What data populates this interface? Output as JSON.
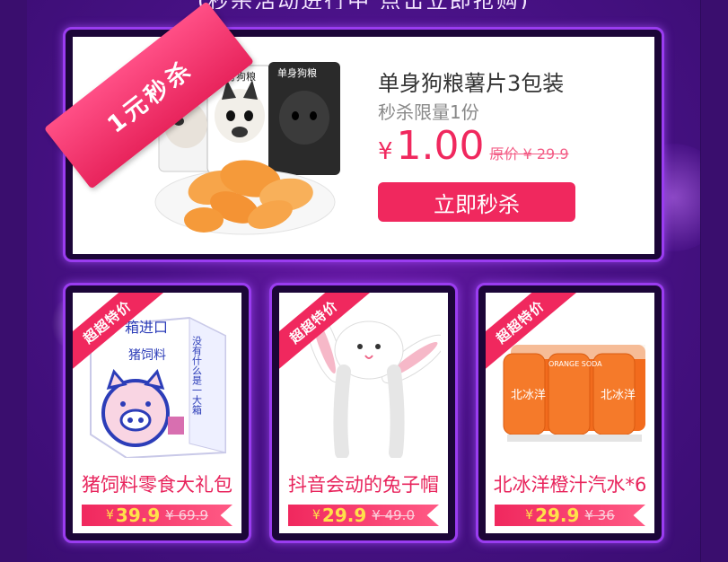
{
  "header_fragment": "(秒杀活动进行中 点击立即抢购)",
  "featured": {
    "ribbon": "1元秒杀",
    "title": "单身狗粮薯片3包装",
    "subtitle": "秒杀限量1份",
    "currency": "¥",
    "price": "1.00",
    "original_price": "原价 ¥ 29.9",
    "buy_label": "立即秒杀",
    "pack_label": "单身狗粮",
    "colors": {
      "accent": "#f0285e",
      "frame": "#9a3cf0"
    }
  },
  "products": [
    {
      "tag": "超超特价",
      "name": "猪饲料零食大礼包",
      "currency": "¥",
      "price": "39.9",
      "original_price": "¥ 69.9",
      "box_text_top": "箱进口",
      "box_text_mid": "猪饲料",
      "box_text_side": "没有什么是一大箱",
      "icon": "pig-snack-box-icon"
    },
    {
      "tag": "超超特价",
      "name": "抖音会动的兔子帽",
      "currency": "¥",
      "price": "29.9",
      "original_price": "¥ 49.0",
      "icon": "bunny-hat-icon"
    },
    {
      "tag": "超超特价",
      "name": "北冰洋橙汁汽水*6",
      "currency": "¥",
      "price": "29.9",
      "original_price": "¥ 36",
      "can_text": "北冰洋",
      "can_sub": "ORANGE SODA",
      "icon": "orange-soda-cans-icon"
    }
  ]
}
